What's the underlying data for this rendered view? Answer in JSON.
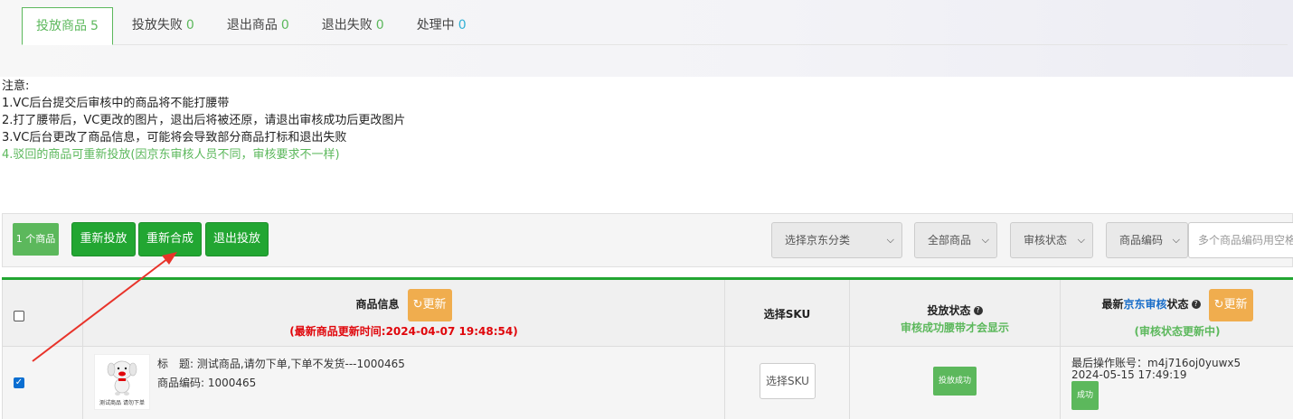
{
  "tabs": [
    {
      "label": "投放商品",
      "count": "5"
    },
    {
      "label": "投放失败",
      "count": "0"
    },
    {
      "label": "退出商品",
      "count": "0"
    },
    {
      "label": "退出失败",
      "count": "0"
    },
    {
      "label": "处理中",
      "count": "0"
    }
  ],
  "notes": {
    "title": "注意:",
    "lines": [
      "1.VC后台提交后审核中的商品将不能打腰带",
      "2.打了腰带后，VC更改的图片，退出后将被还原，请退出审核成功后更改图片",
      "3.VC后台更改了商品信息，可能将会导致部分商品打标和退出失败",
      "4.驳回的商品可重新投放(因京东审核人员不同，审核要求不一样)"
    ]
  },
  "toolbar": {
    "count_badge": "1 个商品",
    "buttons": [
      "重新投放",
      "重新合成",
      "退出投放"
    ],
    "category_select": "选择京东分类",
    "goods_select": "全部商品",
    "audit_select": "审核状态",
    "code_select": "商品编码",
    "code_input_placeholder": "多个商品编码用空格"
  },
  "table": {
    "headers": {
      "product_info": "商品信息",
      "refresh": "更新",
      "update_time": "(最新商品更新时间:2024-04-07 19:48:54)",
      "select_sku": "选择SKU",
      "placement_status": "投放状态",
      "placement_note": "审核成功腰带才会显示",
      "audit_prefix": "最新",
      "audit_link": "京东审核",
      "audit_suffix": "状态",
      "audit_note": "(审核状态更新中)"
    },
    "rows": [
      {
        "checked": true,
        "thumb_caption": "测试商品 请勿下单",
        "title_label": "标　题:",
        "title": "测试商品,请勿下单,下单不发货---1000465",
        "code_label": "商品编码:",
        "code": "1000465",
        "sku_button": "选择SKU",
        "placement_status": "投放成功",
        "operator": "最后操作账号：m4j716oj0yuwx5",
        "operated_at": "2024-05-15 17:49:19",
        "audit_status": "成功"
      }
    ]
  },
  "colors": {
    "accent_green": "#22a632",
    "tab_green": "#5cb85c",
    "orange": "#f0ad4e",
    "red": "#e0060b",
    "arrow_red": "#e8332a"
  }
}
